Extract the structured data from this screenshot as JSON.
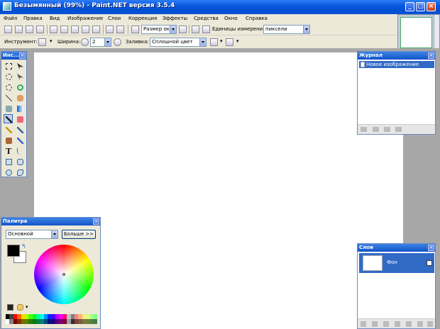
{
  "window": {
    "title": "Безымянный (99%) - Paint.NET версия 3.5.4"
  },
  "menu": [
    "Файл",
    "Правка",
    "Вид",
    "Изображение",
    "Слои",
    "Коррекция",
    "Эффекты",
    "Средства",
    "Окно",
    "Справка"
  ],
  "toolbar1": {
    "zoom_value": "Размер ок",
    "units_label": "Единицы измерения:",
    "units_value": "пиксели"
  },
  "toolbar2": {
    "tool_label": "Инструмент:",
    "width_label": "Ширина:",
    "width_value": "2",
    "fill_label": "Заливка:",
    "fill_value": "Сплошной цвет"
  },
  "tools_panel": {
    "title": "Инс..."
  },
  "history_panel": {
    "title": "Журнал",
    "items": [
      "Новое изображение"
    ]
  },
  "palette_panel": {
    "title": "Палитра",
    "mode_value": "Основной",
    "more_label": "Больше >>"
  },
  "layers_panel": {
    "title": "Слои",
    "layers": [
      {
        "name": "Фон",
        "visible": true
      }
    ]
  },
  "colors": {
    "accent": "#316ac5",
    "primary": "#000000",
    "secondary": "#ffffff"
  }
}
